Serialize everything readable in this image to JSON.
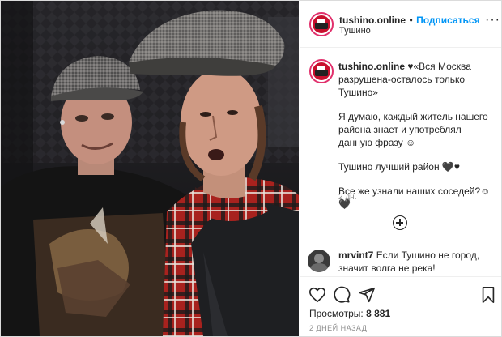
{
  "post": {
    "username": "tushino.online",
    "follow_separator": "•",
    "follow_label": "Подписаться",
    "location": "Тушино",
    "more_label": "···"
  },
  "caption": {
    "username": "tushino.online",
    "lines": [
      "♥«Вся Москва разрушена-осталось только Тушино»",
      "Я думаю, каждый житель нашего района знает и употреблял данную фразу ☺",
      "Тушино лучший район 🖤♥",
      "Все же узнали наших соседей?☺🖤"
    ],
    "time_ago": "2 дн."
  },
  "comment": {
    "username": "mrvint7",
    "text": "Если Тушино не город, значит волга не река!"
  },
  "footer": {
    "views_label": "Просмотры:",
    "views_count": "8 881",
    "date": "2 ДНЕЙ НАЗАД"
  },
  "icons": [
    "heart-icon",
    "comment-icon",
    "share-icon",
    "bookmark-icon",
    "add-comment-icon",
    "more-options-icon"
  ],
  "colors": {
    "follow": "#0095f6",
    "story_ring": "#e1306c",
    "muted": "#8e8e8e"
  }
}
